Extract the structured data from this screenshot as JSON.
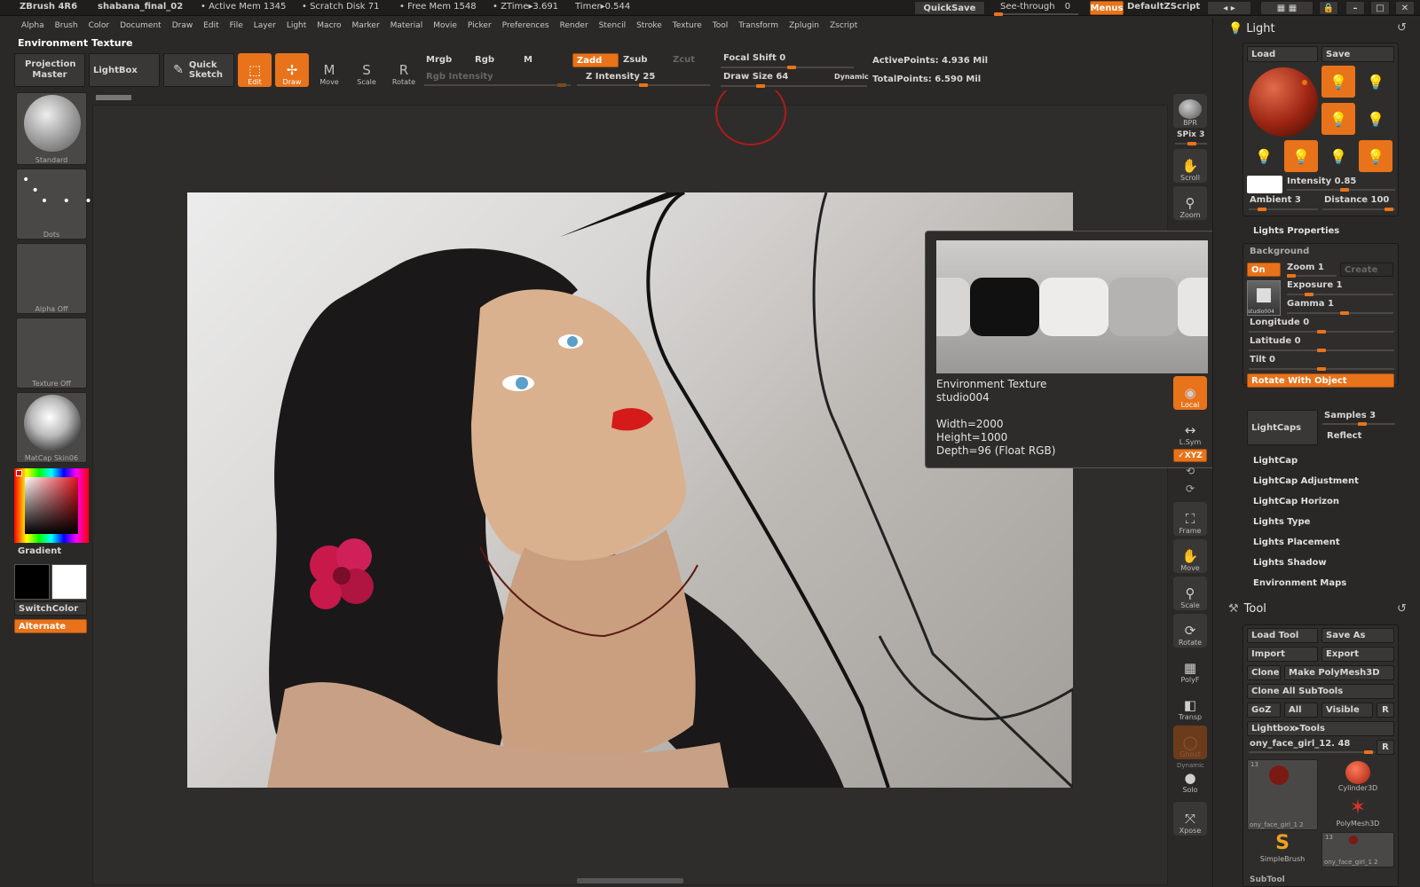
{
  "titlebar": {
    "app": "ZBrush 4R6",
    "file": "shabana_final_02",
    "active_mem": "• Active Mem 1345",
    "scratch_disk": "• Scratch Disk 71",
    "free_mem": "• Free Mem 1548",
    "ztime": "• ZTime▸3.691",
    "timer": "Timer▸0.544",
    "quicksave": "QuickSave",
    "see_through": "See-through",
    "see_through_val": "0",
    "menus": "Menus",
    "default_zscript": "DefaultZScript"
  },
  "menubar": [
    "Alpha",
    "Brush",
    "Color",
    "Document",
    "Draw",
    "Edit",
    "File",
    "Layer",
    "Light",
    "Macro",
    "Marker",
    "Material",
    "Movie",
    "Picker",
    "Preferences",
    "Render",
    "Stencil",
    "Stroke",
    "Texture",
    "Tool",
    "Transform",
    "Zplugin",
    "Zscript"
  ],
  "tooltip_header": "Environment Texture",
  "toolbar": {
    "projection_master": "Projection Master",
    "lightbox": "LightBox",
    "quick_sketch": "Quick Sketch",
    "edit": "Edit",
    "draw": "Draw",
    "move": "Move",
    "scale": "Scale",
    "rotate": "Rotate",
    "mrgb": "Mrgb",
    "rgb": "Rgb",
    "m": "M",
    "zadd": "Zadd",
    "zsub": "Zsub",
    "zcut": "Zcut",
    "rgb_intensity": "Rgb Intensity",
    "z_intensity": "Z Intensity 25",
    "focal_shift": "Focal Shift 0",
    "draw_size": "Draw Size 64",
    "dynamic": "Dynamic",
    "active_points": "ActivePoints: 4.936 Mil",
    "total_points": "TotalPoints: 6.590 Mil"
  },
  "left_shelf": {
    "brush": "Standard",
    "stroke": "Dots",
    "alpha": "Alpha Off",
    "texture": "Texture Off",
    "material": "MatCap Skin06",
    "gradient": "Gradient",
    "switchcolor": "SwitchColor",
    "alternate": "Alternate"
  },
  "right_shelf": {
    "bpr": "BPR",
    "spix": "SPix 3",
    "scroll": "Scroll",
    "zoom": "Zoom",
    "local": "Local",
    "lsym": "L.Sym",
    "xyz": "✓XYZ",
    "frame": "Frame",
    "move": "Move",
    "scale": "Scale",
    "rotate": "Rotate",
    "polyf": "PolyF",
    "transp": "Transp",
    "ghost": "Ghost",
    "dynamic": "Dynamic",
    "solo": "Solo",
    "xpose": "Xpose"
  },
  "env_popup": {
    "title": "Environment Texture",
    "name": "studio004",
    "width": "Width=2000",
    "height": "Height=1000",
    "depth": "Depth=96 (Float RGB)"
  },
  "light_panel": {
    "title": "Light",
    "load": "Load",
    "save": "Save",
    "intensity": "Intensity 0.85",
    "ambient": "Ambient 3",
    "distance": "Distance 100",
    "lights_properties": "Lights Properties",
    "background": "Background",
    "on": "On",
    "zoom": "Zoom 1",
    "create": "Create",
    "exposure": "Exposure 1",
    "gamma": "Gamma 1",
    "thumb_label": "studio004",
    "longitude": "Longitude 0",
    "latitude": "Latitude 0",
    "tilt": "Tilt 0",
    "rotate_with_object": "Rotate With Object",
    "lightcaps": "LightCaps",
    "samples": "Samples 3",
    "reflect": "Reflect",
    "items": [
      "LightCap",
      "LightCap Adjustment",
      "LightCap Horizon",
      "Lights Type",
      "Lights Placement",
      "Lights Shadow",
      "Environment Maps"
    ]
  },
  "tool_panel": {
    "title": "Tool",
    "load_tool": "Load Tool",
    "save_as": "Save As",
    "import": "Import",
    "export": "Export",
    "clone": "Clone",
    "make_polymesh": "Make PolyMesh3D",
    "clone_all": "Clone All SubTools",
    "goz": "GoZ",
    "all": "All",
    "visible": "Visible",
    "r": "R",
    "lightbox_tools": "Lightbox▸Tools",
    "current_tool": "ony_face_girl_12. 48",
    "thumb_count1": "13",
    "thumb_name1": "ony_face_girl_1 2",
    "cylinder": "Cylinder3D",
    "polymesh": "PolyMesh3D",
    "simplebrush": "SimpleBrush",
    "thumb_count2": "13",
    "thumb_name2": "ony_face_girl_1 2",
    "subtool": "SubTool"
  },
  "colors": {
    "accent": "#e8731b",
    "panel": "#2b2927",
    "button": "#3a3836"
  }
}
